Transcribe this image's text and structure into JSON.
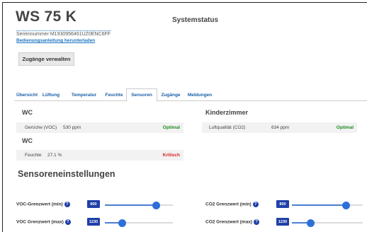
{
  "header": {
    "device_title": "WS 75 K",
    "system_title": "Systemstatus",
    "serial": "Seriennummer M1930956461UZ0ENC6FF",
    "manual_link": "Bedienungsanleitung herunterladen",
    "access_button": "Zugänge verwalten"
  },
  "tabs": [
    {
      "label": "Übersicht"
    },
    {
      "label": "Lüftung"
    },
    {
      "label": "Temperatur"
    },
    {
      "label": "Feuchte"
    },
    {
      "label": "Sensoren"
    },
    {
      "label": "Zugänge"
    },
    {
      "label": "Meldungen"
    }
  ],
  "active_tab": "Sensoren",
  "sensors": {
    "left_section_1": "WC",
    "left_section_2": "WC",
    "right_section": "Kinderzimmer",
    "voc": {
      "label": "Gerüche (VOC)",
      "value": "530 ppm",
      "status": "Optimal"
    },
    "humidity": {
      "label": "Feuchte",
      "value": "27.1 %",
      "status": "Kritisch"
    },
    "co2": {
      "label": "Luftqualität (CO2)",
      "value": "634 ppm",
      "status": "Optimal"
    }
  },
  "settings": {
    "title": "Sensoreneinstellungen",
    "help_glyph": "?",
    "voc_min": {
      "label": "VOC-Grenzwert (min)",
      "value": "800",
      "level": 0.76
    },
    "voc_max": {
      "label": "VOC Grenzwert (max)",
      "value": "1230",
      "level": 0.26
    },
    "co2_min": {
      "label": "CO2 Grenzwert (min)",
      "value": "800",
      "level": 0.76
    },
    "co2_max": {
      "label": "CO2 Grenzwert (max)",
      "value": "1230",
      "level": 0.26
    }
  },
  "colors": {
    "accent": "#1f3fa8",
    "link": "#1a73c0",
    "ok": "#1f8a1f",
    "critical": "#d92020"
  }
}
